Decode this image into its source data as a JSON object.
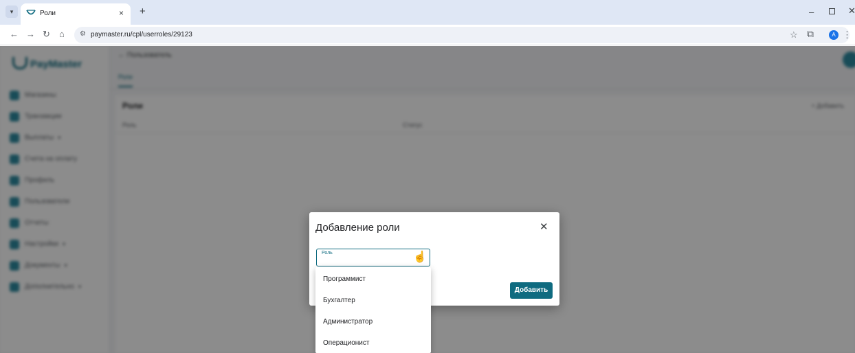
{
  "browser": {
    "tab_title": "Роли",
    "url": "paymaster.ru/cpl/userroles/29123",
    "profile_initial": "A"
  },
  "page": {
    "logo_text": "PayMaster",
    "breadcrumb": "← Пользователь",
    "subtab_label": "Роли",
    "card_title": "Роли",
    "card_action": "+ Добавить",
    "col_name": "Роль",
    "col_status": "Статус",
    "sidebar_items": [
      {
        "label": "Магазины",
        "chevron": ""
      },
      {
        "label": "Транзакции",
        "chevron": ""
      },
      {
        "label": "Выплаты",
        "chevron": "▾"
      },
      {
        "label": "Счета на оплату",
        "chevron": ""
      },
      {
        "label": "Профиль",
        "chevron": ""
      },
      {
        "label": "Пользователи",
        "chevron": ""
      },
      {
        "label": "Отчеты",
        "chevron": ""
      },
      {
        "label": "Настройки",
        "chevron": "▾"
      },
      {
        "label": "Документы",
        "chevron": "▾"
      },
      {
        "label": "Дополнительно",
        "chevron": "▾"
      }
    ]
  },
  "dialog": {
    "title": "Добавление роли",
    "close_glyph": "✕",
    "field_label": "Роль",
    "add_button": "Добавить"
  },
  "dropdown": {
    "options": [
      "Программист",
      "Бухгалтер",
      "Администратор",
      "Операционист"
    ]
  },
  "colors": {
    "accent": "#0f6b80",
    "overlay": "rgba(0,0,0,0.45)"
  }
}
